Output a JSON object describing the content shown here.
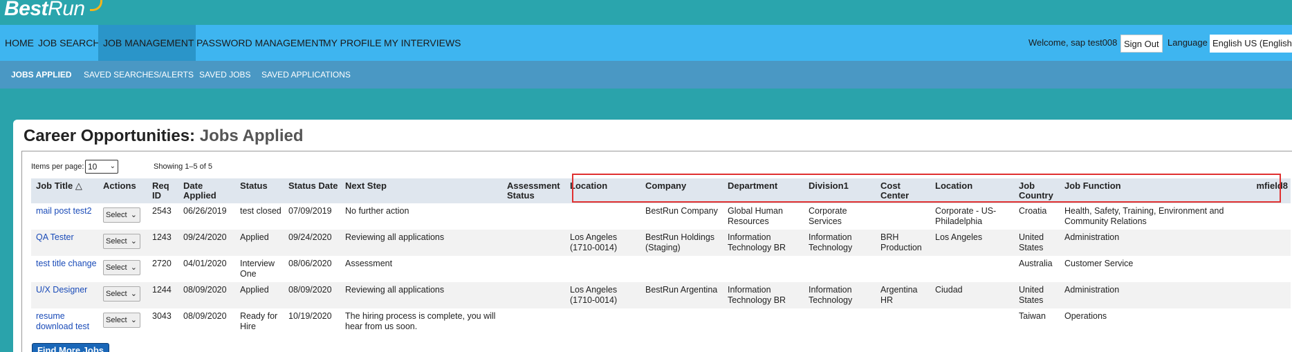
{
  "brand": {
    "logo_bold": "Best",
    "logo_thin": "Run"
  },
  "nav": {
    "items": [
      "HOME",
      "JOB SEARCH",
      "JOB MANAGEMENT",
      "PASSWORD MANAGEMENT",
      "MY PROFILE",
      "MY INTERVIEWS"
    ],
    "active_index": 2,
    "welcome": "Welcome, sap test008",
    "sign_out": "Sign Out",
    "language_label": "Language",
    "language_value": "English US (English"
  },
  "subnav": {
    "items": [
      "JOBS APPLIED",
      "SAVED SEARCHES/ALERTS",
      "SAVED JOBS",
      "SAVED APPLICATIONS"
    ],
    "active_index": 0
  },
  "page": {
    "title_main": "Career Opportunities:",
    "title_sub": "Jobs Applied",
    "items_per_page_label": "Items per page:",
    "items_per_page_value": "10",
    "showing": "Showing 1–5 of 5",
    "find_more": "Find More Jobs"
  },
  "table": {
    "columns": [
      "Job Title",
      "Actions",
      "Req ID",
      "Date Applied",
      "Status",
      "Status Date",
      "Next Step",
      "Assessment Status",
      "Location",
      "Company",
      "Department",
      "Division1",
      "Cost Center",
      "Location",
      "Job Country",
      "Job Function",
      "mfield8"
    ],
    "sort_indicator": "△",
    "select_label": "Select",
    "rows": [
      {
        "title": "mail post test2",
        "req": "2543",
        "applied": "06/26/2019",
        "status": "test closed",
        "status_date": "07/09/2019",
        "next": "No further action",
        "assess": "",
        "loc1": "",
        "company": "BestRun Company",
        "dept": "Global Human Resources",
        "div": "Corporate Services",
        "cost": "",
        "loc2": "Corporate - US-Philadelphia",
        "country": "Croatia",
        "function": "Health, Safety, Training, Environment and Community Relations",
        "mfield8": ""
      },
      {
        "title": "QA Tester",
        "req": "1243",
        "applied": "09/24/2020",
        "status": "Applied",
        "status_date": "09/24/2020",
        "next": "Reviewing all applications",
        "assess": "",
        "loc1": "Los Angeles (1710-0014)",
        "company": "BestRun Holdings (Staging)",
        "dept": "Information Technology BR",
        "div": "Information Technology",
        "cost": "BRH Production",
        "loc2": "Los Angeles",
        "country": "United States",
        "function": "Administration",
        "mfield8": ""
      },
      {
        "title": "test title change",
        "req": "2720",
        "applied": "04/01/2020",
        "status": "Interview One",
        "status_date": "08/06/2020",
        "next": "Assessment",
        "assess": "",
        "loc1": "",
        "company": "",
        "dept": "",
        "div": "",
        "cost": "",
        "loc2": "",
        "country": "Australia",
        "function": "Customer Service",
        "mfield8": ""
      },
      {
        "title": "U/X Designer",
        "req": "1244",
        "applied": "08/09/2020",
        "status": "Applied",
        "status_date": "08/09/2020",
        "next": "Reviewing all applications",
        "assess": "",
        "loc1": "Los Angeles (1710-0014)",
        "company": "BestRun Argentina",
        "dept": "Information Technology BR",
        "div": "Information Technology",
        "cost": "Argentina HR",
        "loc2": "Ciudad",
        "country": "United States",
        "function": "Administration",
        "mfield8": ""
      },
      {
        "title": "resume download test",
        "req": "3043",
        "applied": "08/09/2020",
        "status": "Ready for Hire",
        "status_date": "10/19/2020",
        "next": "The hiring process is complete, you will hear from us soon.",
        "assess": "",
        "loc1": "",
        "company": "",
        "dept": "",
        "div": "",
        "cost": "",
        "loc2": "",
        "country": "Taiwan",
        "function": "Operations",
        "mfield8": ""
      }
    ]
  },
  "colors": {
    "accent_highlight": "#e03030",
    "nav_bg": "#3eb5f0",
    "subnav_bg": "#4a98c4",
    "link": "#1a4bb8"
  }
}
